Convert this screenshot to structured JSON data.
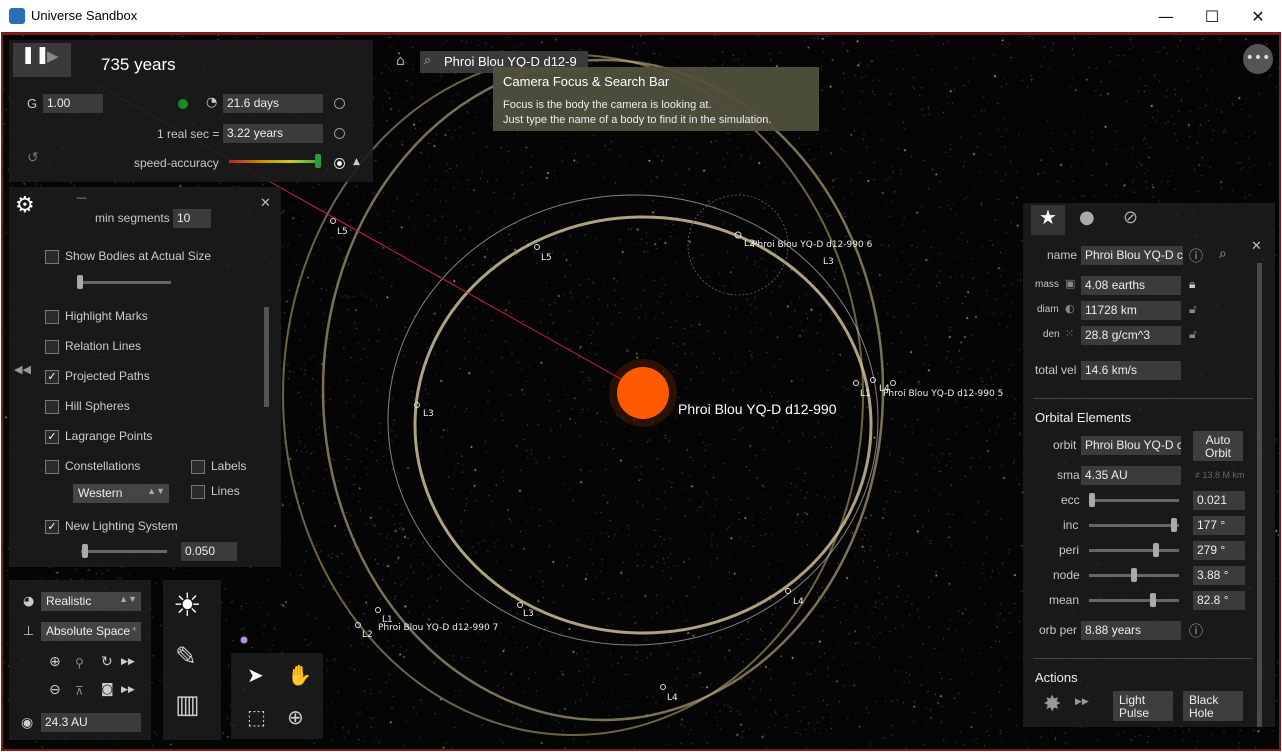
{
  "window": {
    "title": "Universe Sandbox",
    "minimize": "—",
    "maximize": "☐",
    "close": "✕"
  },
  "sim": {
    "time": "735 years",
    "gravity_label": "G",
    "gravity": "1.00",
    "timestep": "21.6 days",
    "real_sec_label": "1 real sec =",
    "real_sec": "3.22 years",
    "speed_accuracy_label": "speed-accuracy"
  },
  "search": {
    "value": "Phroi Blou YQ-D d12-9"
  },
  "tooltip": {
    "title": "Camera Focus & Search Bar",
    "line1": "Focus is the body the camera is looking at.",
    "line2": "Just type the name of a body to find it in the simulation."
  },
  "settings": {
    "min_segments_label": "min segments",
    "min_segments": "10",
    "show_bodies": "Show Bodies at Actual Size",
    "highlight_marks": "Highlight Marks",
    "relation_lines": "Relation Lines",
    "projected_paths": "Projected Paths",
    "hill_spheres": "Hill Spheres",
    "lagrange_points": "Lagrange Points",
    "constellations": "Constellations",
    "labels": "Labels",
    "lines": "Lines",
    "constellation_style": "Western",
    "new_lighting": "New Lighting System",
    "lighting_value": "0.050"
  },
  "view": {
    "mode": "Realistic",
    "space": "Absolute Space",
    "scale": "24.3 AU"
  },
  "body": {
    "name_label": "name",
    "name": "Phroi Blou YQ-D c",
    "mass_label": "mass",
    "mass": "4.08 earths",
    "diam_label": "diam",
    "diam": "11728 km",
    "den_label": "den",
    "den": "28.8 g/cm^3",
    "vel_label": "total vel",
    "vel": "14.6 km/s"
  },
  "orbit": {
    "heading": "Orbital Elements",
    "orbit_label": "orbit",
    "orbit": "Phroi Blou YQ-D c",
    "auto_orbit": "Auto Orbit",
    "sma_label": "sma",
    "sma": "4.35 AU",
    "sma_hint": "≠ 13.8 M km",
    "ecc_label": "ecc",
    "ecc": "0.021",
    "inc_label": "inc",
    "inc": "177 °",
    "peri_label": "peri",
    "peri": "279 °",
    "node_label": "node",
    "node": "3.88 °",
    "mean_label": "mean",
    "mean": "82.8 °",
    "orb_per_label": "orb per",
    "orb_per": "8.88 years"
  },
  "actions": {
    "heading": "Actions",
    "light_pulse": "Light Pulse",
    "black_hole": "Black Hole"
  },
  "scene": {
    "star_label": "Phroi Blou YQ-D d12-990",
    "l5a": "L5",
    "l5b": "L5",
    "l3a": "L3",
    "l3b": "L3",
    "l3c": "L3",
    "l4a": "L4",
    "l4b": "L4",
    "l4c": "L4",
    "l1a": "L1",
    "l1b": "L1",
    "l2a": "L2",
    "l2b": "L2",
    "p6": "Phroi Blou YQ-D d12-990 6",
    "p5": "Phroi Blou YQ-D d12-990 5",
    "p7": "Phroi Blou YQ-D d12-990 7"
  },
  "colors": {
    "frame": "#7a1c1c",
    "star": "#ff5a00",
    "orbit": "#c9b98a",
    "panel": "#1c1c1c"
  }
}
